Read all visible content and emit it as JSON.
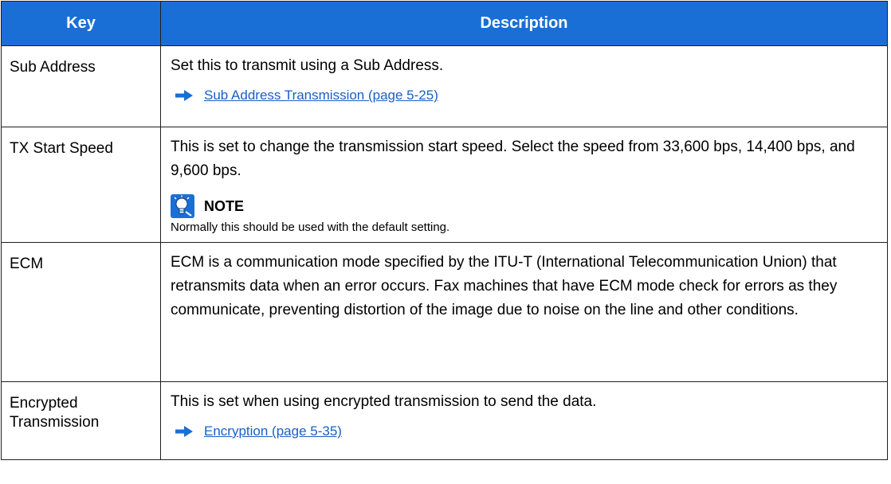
{
  "header": {
    "key": "Key",
    "description": "Description"
  },
  "rows": [
    {
      "key": "Sub Address",
      "description": "Set this to transmit using a Sub Address.",
      "link": "Sub Address Transmission (page 5-25)"
    },
    {
      "key": "TX Start Speed",
      "description": "This is set to change the transmission start speed. Select the speed from 33,600 bps, 14,400 bps, and 9,600 bps.",
      "note_title": "NOTE",
      "note_text": "Normally this should be used with the default setting."
    },
    {
      "key": "ECM",
      "description": "ECM is a communication mode specified by the ITU-T (International Telecommunication Union) that retransmits data when an error occurs. Fax machines that have ECM mode check for errors as they communicate, preventing distortion of the image due to noise on the line and other conditions."
    },
    {
      "key": "Encrypted Transmission",
      "description": "This is set when using encrypted transmission to send the data.",
      "link": "Encryption (page 5-35)"
    }
  ],
  "colors": {
    "header_bg": "#1a6fd6",
    "header_text": "#ffffff",
    "link": "#1a5fc4",
    "arrow": "#1a6fd6",
    "border": "#1f1f1f"
  },
  "icons": {
    "link_arrow": "arrow-right-icon",
    "note": "lightbulb-icon"
  }
}
